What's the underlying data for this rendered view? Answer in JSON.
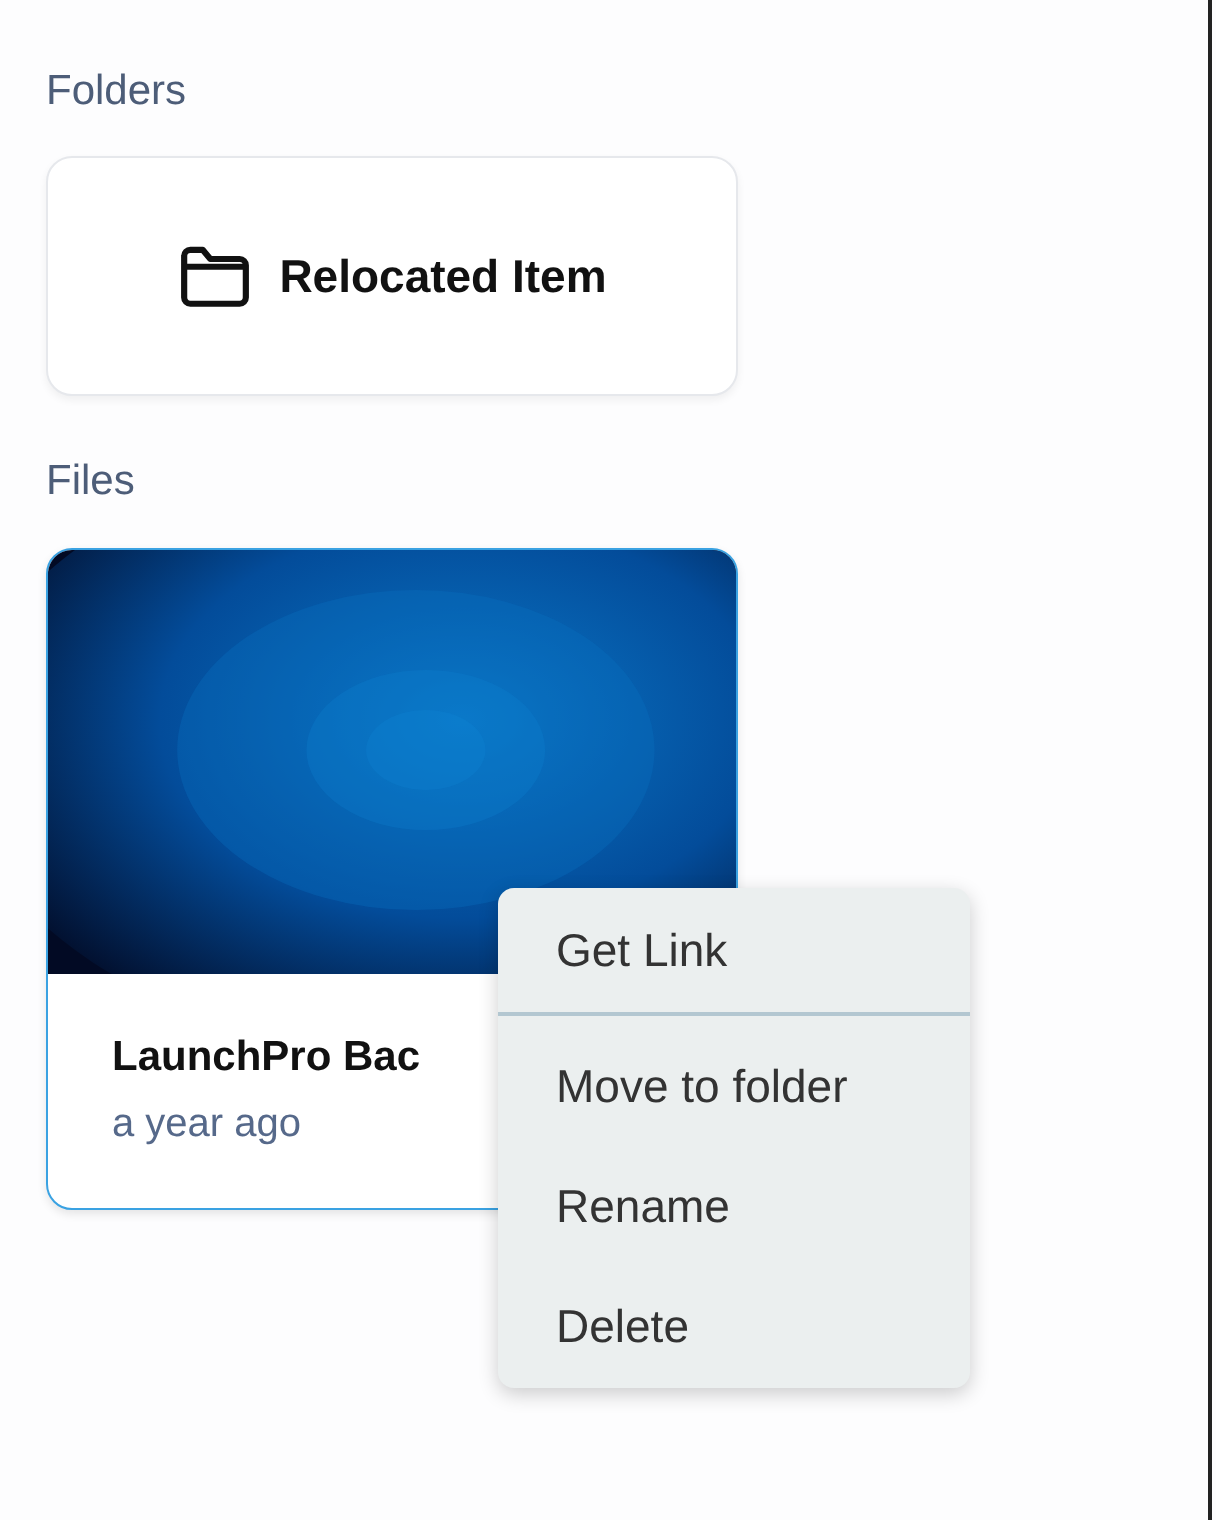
{
  "folders_section": {
    "heading": "Folders",
    "folders": [
      {
        "name": "Relocated Item"
      }
    ]
  },
  "files_section": {
    "heading": "Files",
    "files": [
      {
        "name": "LaunchPro Bac",
        "modified": "a year ago"
      }
    ]
  },
  "context_menu": {
    "groups": [
      [
        "Get Link"
      ],
      [
        "Move to folder",
        "Rename",
        "Delete"
      ]
    ]
  }
}
